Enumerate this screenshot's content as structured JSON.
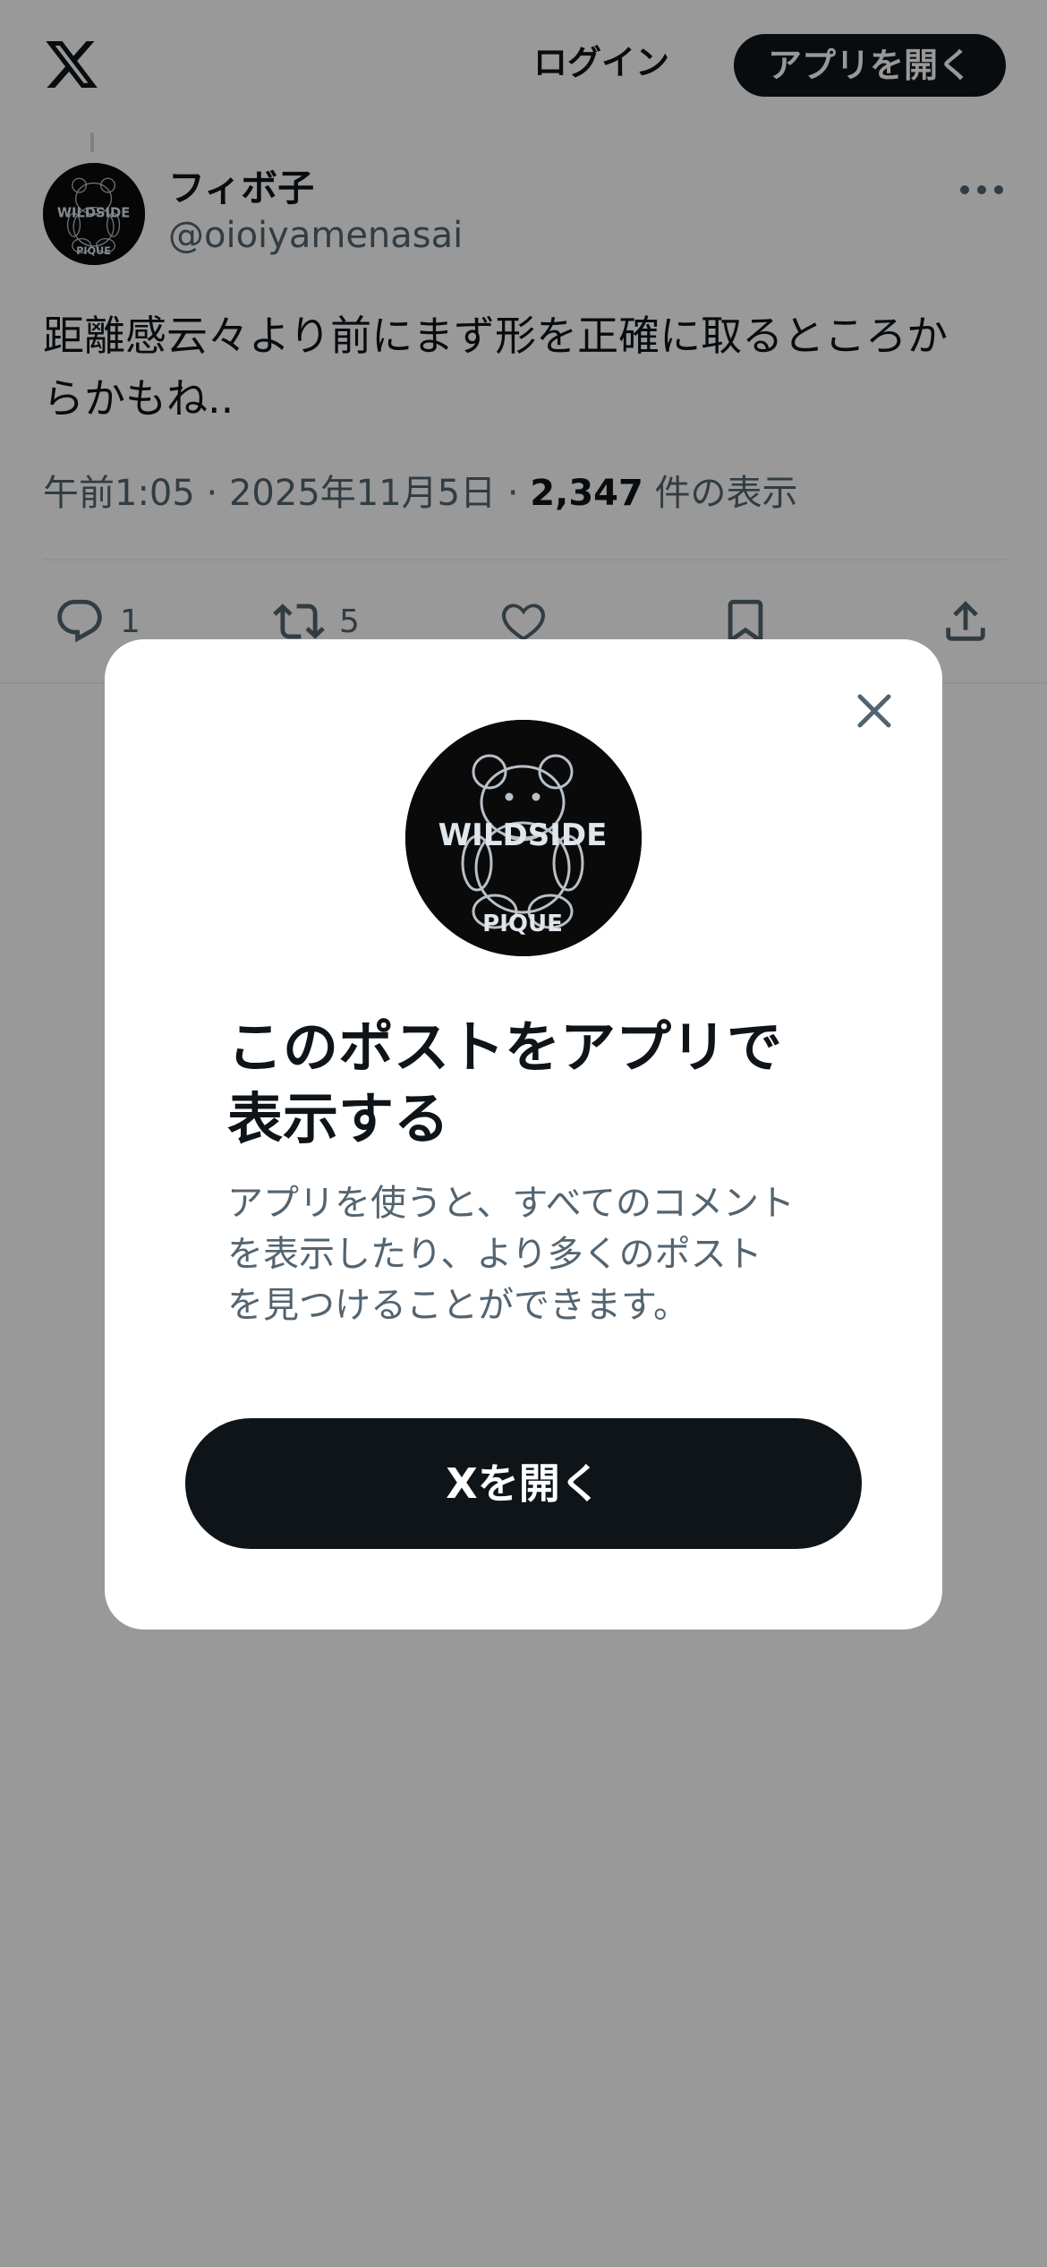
{
  "header": {
    "logo_icon": "x-logo-icon",
    "login_label": "ログイン",
    "open_app_label": "アプリを開く"
  },
  "post": {
    "author": {
      "display_name": "フィボ子",
      "handle": "@oioiyamenasai",
      "avatar_text_top": "WILDSIDE",
      "avatar_text_bottom": "PIQUE"
    },
    "more_icon": "more-horizontal-icon",
    "text_line1": "距離感云々より前にまず形を正確に取るところか",
    "text_line2": "らかもね..",
    "time": "午前1:05",
    "date": "2025年11月5日",
    "separator": "·",
    "view_count": "2,347",
    "view_suffix": "件の表示",
    "actions": {
      "reply_icon": "reply-icon",
      "reply_count": "1",
      "retweet_icon": "retweet-icon",
      "retweet_count": "5",
      "like_icon": "heart-icon",
      "bookmark_icon": "bookmark-icon",
      "share_icon": "share-icon"
    }
  },
  "modal": {
    "close_icon": "close-icon",
    "title_line1": "このポストをアプリで",
    "title_line2": "表示する",
    "desc_line1": "アプリを使うと、すべてのコメント",
    "desc_line2": "を表示したり、より多くのポスト",
    "desc_line3": "を見つけることができます。",
    "cta_label": "Xを開く"
  },
  "colors": {
    "primary_text": "#0f1419",
    "secondary_text": "#536471",
    "button_dark": "#0f1419",
    "overlay": "rgba(0,0,0,0.4)"
  }
}
